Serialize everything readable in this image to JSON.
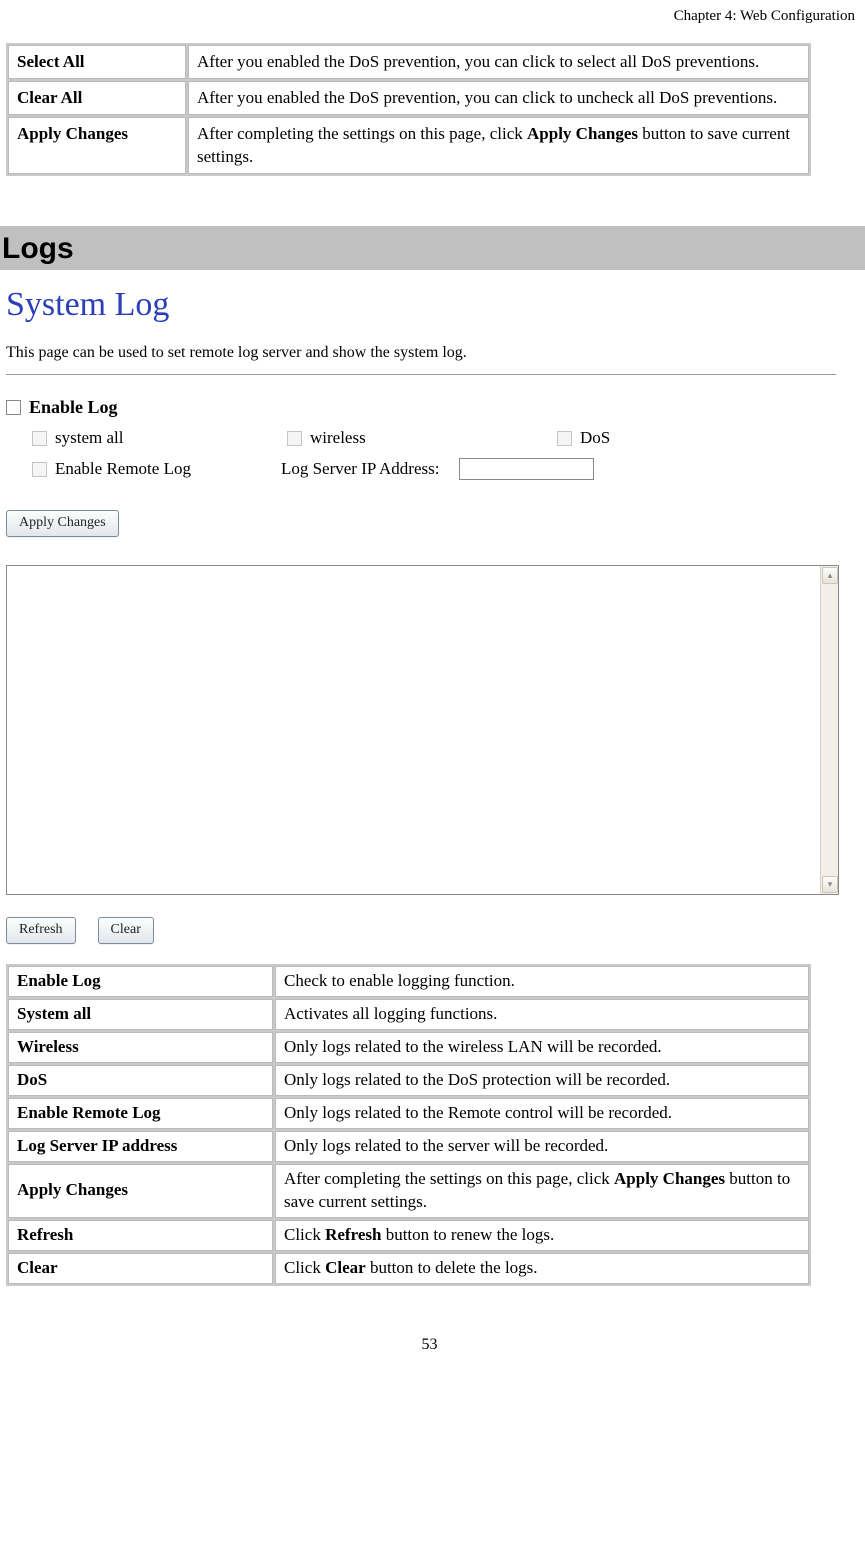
{
  "header": "Chapter 4: Web Configuration",
  "page_number": "53",
  "table1": {
    "rows": [
      {
        "label": "Select All",
        "desc": "After you enabled the DoS prevention, you can click to select all DoS preventions."
      },
      {
        "label": "Clear All",
        "desc": "After you enabled the DoS prevention, you can click to uncheck all DoS preventions."
      },
      {
        "label": "Apply Changes",
        "desc_pre": "After completing the settings on this page, click ",
        "desc_bold": "Apply Changes",
        "desc_post": " button to save current settings."
      }
    ]
  },
  "section_heading": "Logs",
  "syslog": {
    "title": "System Log",
    "subtitle": "This page can be used to set remote log server and show the system log.",
    "enable_log_label": "Enable Log",
    "system_all_label": "system all",
    "wireless_label": "wireless",
    "dos_label": "DoS",
    "enable_remote_label": "Enable Remote Log",
    "log_server_ip_label": "Log Server IP Address:",
    "apply_btn": "Apply Changes",
    "refresh_btn": "Refresh",
    "clear_btn": "Clear"
  },
  "table2": {
    "rows": [
      {
        "label": "Enable Log",
        "desc": "Check to enable logging function."
      },
      {
        "label": "System all",
        "desc": "Activates all logging functions."
      },
      {
        "label": "Wireless",
        "desc": "Only logs related to the wireless LAN will be recorded."
      },
      {
        "label": "DoS",
        "desc": "Only logs related to the DoS protection will be recorded."
      },
      {
        "label": "Enable Remote Log",
        "desc": "Only logs related to the Remote control will be recorded."
      },
      {
        "label": "Log Server IP address",
        "desc": "Only logs related to the server will be recorded."
      },
      {
        "label": "Apply Changes",
        "desc_pre": "After completing the settings on this page, click ",
        "desc_bold": "Apply Changes",
        "desc_post": " button to save current settings."
      },
      {
        "label": "Refresh",
        "desc_pre": "Click ",
        "desc_bold": "Refresh",
        "desc_post": " button to renew the logs."
      },
      {
        "label": "Clear",
        "desc_pre": "Click ",
        "desc_bold": "Clear",
        "desc_post": " button to delete the logs."
      }
    ]
  }
}
